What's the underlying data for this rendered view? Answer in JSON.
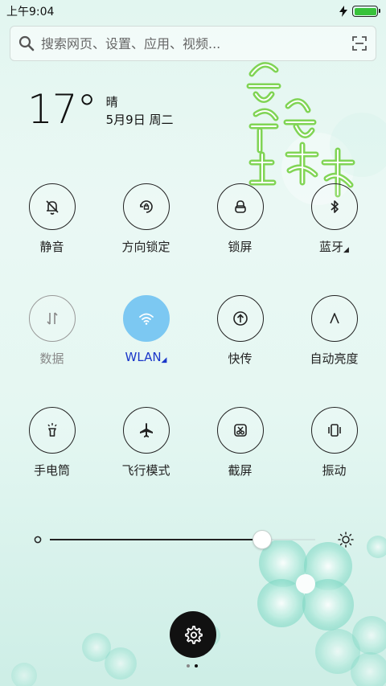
{
  "status_bar": {
    "time": "上午9:04",
    "battery_level": 1.0,
    "charging": true
  },
  "search": {
    "placeholder": "搜索网页、设置、应用、视频..."
  },
  "weather": {
    "temperature": "17°",
    "condition": "晴",
    "date": "5月9日 周二"
  },
  "toggles": [
    {
      "label": "静音",
      "icon": "bell-off-icon",
      "state": "on"
    },
    {
      "label": "方向锁定",
      "icon": "rotation-lock-icon",
      "state": "on"
    },
    {
      "label": "锁屏",
      "icon": "lock-icon",
      "state": "on"
    },
    {
      "label": "蓝牙",
      "icon": "bluetooth-icon",
      "state": "on",
      "has_more": true
    },
    {
      "label": "数据",
      "icon": "mobile-data-icon",
      "state": "off"
    },
    {
      "label": "WLAN",
      "icon": "wifi-icon",
      "state": "active",
      "has_more": true
    },
    {
      "label": "快传",
      "icon": "quick-transfer-icon",
      "state": "on"
    },
    {
      "label": "自动亮度",
      "icon": "auto-brightness-icon",
      "state": "on"
    },
    {
      "label": "手电筒",
      "icon": "flashlight-icon",
      "state": "on"
    },
    {
      "label": "飞行模式",
      "icon": "airplane-icon",
      "state": "on"
    },
    {
      "label": "截屏",
      "icon": "screenshot-icon",
      "state": "on"
    },
    {
      "label": "振动",
      "icon": "vibrate-icon",
      "state": "on"
    }
  ],
  "brightness": {
    "level": 0.8
  },
  "pager": {
    "current_page": 2,
    "page_count": 2
  },
  "colors": {
    "wlan_active": "#7cc8f2",
    "wlan_label": "#1a37c9",
    "battery": "#38c23a"
  }
}
